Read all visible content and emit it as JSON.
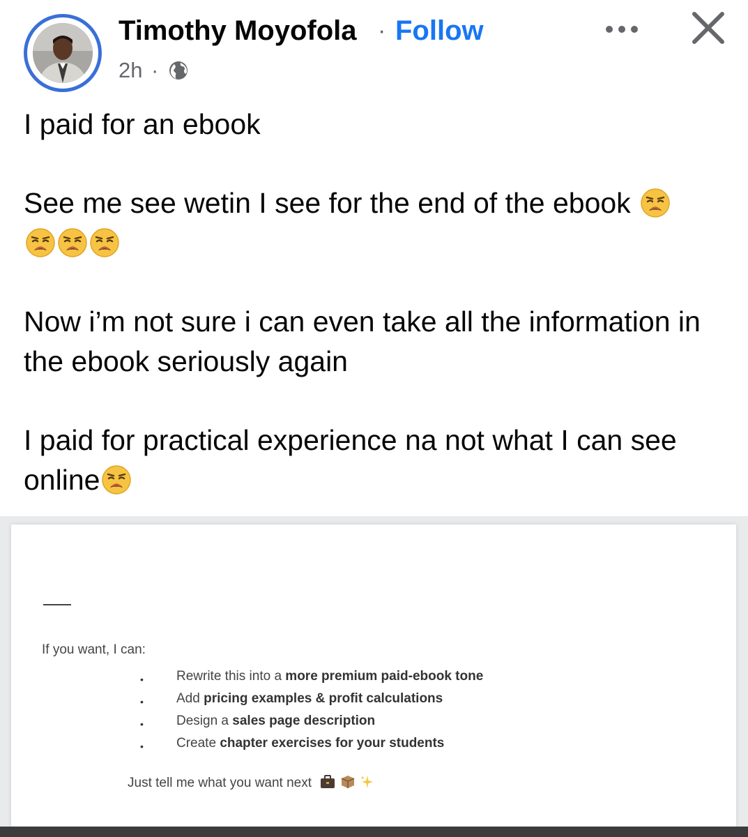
{
  "post": {
    "author": "Timothy Moyofola",
    "name_separator": "·",
    "follow_label": "Follow",
    "time": "2h",
    "time_separator": "·",
    "audience_icon": "globe-icon",
    "menu_icon": "more-options-icon",
    "close_icon": "close-icon",
    "accent_color": "#1877f2",
    "avatar_ring_color": "#3a6fd8"
  },
  "body": {
    "paragraph_1": "I paid for an ebook",
    "paragraph_2": "See me see wetin I see for the end of the ebook",
    "paragraph_2_emoji": "weary-face-emoji",
    "paragraph_2_emoji_count": 4,
    "paragraph_3": "Now i’m not sure i can even take all the information in the ebook seriously again",
    "paragraph_4": "I paid for practical experience na not what I can see online",
    "paragraph_4_emoji": "weary-face-emoji"
  },
  "screenshot": {
    "intro": "If you want, I can:",
    "items": [
      {
        "bullet": "•",
        "prefix": "Rewrite this into a ",
        "bold": "more premium paid-ebook tone"
      },
      {
        "bullet": "•",
        "prefix": "Add ",
        "bold": "pricing examples & profit calculations"
      },
      {
        "bullet": "•",
        "prefix": "Design a ",
        "bold": "sales page description"
      },
      {
        "bullet": "•",
        "prefix": "Create ",
        "bold": "chapter exercises for your students"
      }
    ],
    "outro": "Just tell me what you want next",
    "outro_icons": [
      "briefcase-icon",
      "package-icon",
      "sparkles-icon"
    ]
  }
}
